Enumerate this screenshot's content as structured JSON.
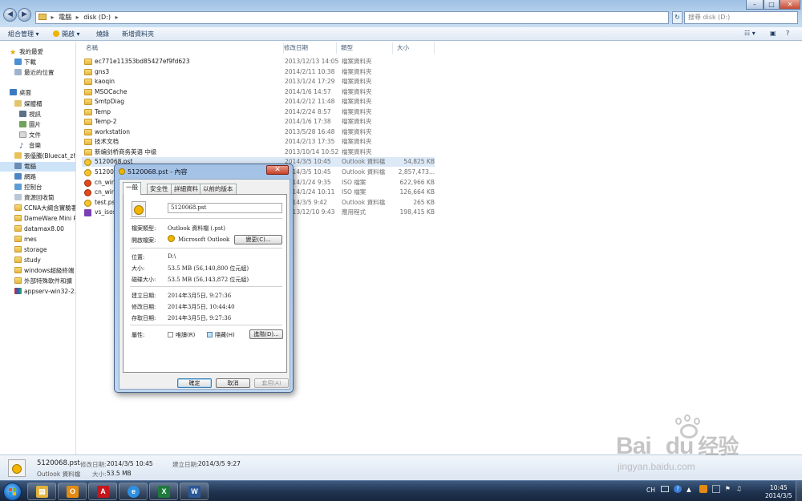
{
  "window": {
    "address": [
      "電腦",
      "disk (D:)"
    ],
    "search_placeholder": "搜尋 disk (D:)",
    "controls": [
      "–",
      "□",
      "✕"
    ]
  },
  "toolbar": {
    "organize": "組合管理",
    "open": "開啟",
    "burn": "燒錄",
    "new_folder": "新增資料夾"
  },
  "navpane": {
    "items": [
      {
        "label": "我的最愛",
        "icon": "star-icon"
      },
      {
        "label": "下載",
        "icon": "download-folder-icon"
      },
      {
        "label": "最近的位置",
        "icon": "recent-places-icon"
      },
      {
        "label": "桌面",
        "icon": "desktop-icon"
      },
      {
        "label": "媒體櫃",
        "icon": "library-icon"
      },
      {
        "label": "視訊",
        "icon": "video-icon"
      },
      {
        "label": "圖片",
        "icon": "picture-icon"
      },
      {
        "label": "文件",
        "icon": "document-icon"
      },
      {
        "label": "音樂",
        "icon": "music-icon"
      },
      {
        "label": "張優騰(Bluecat_zha",
        "icon": "user-folder-icon"
      },
      {
        "label": "電腦",
        "icon": "computer-icon"
      },
      {
        "label": "網路",
        "icon": "network-icon"
      },
      {
        "label": "控制台",
        "icon": "control-panel-icon"
      },
      {
        "label": "資源回收筒",
        "icon": "recycle-bin-icon"
      },
      {
        "label": "CCNA大綱含實驗著",
        "icon": "folder-icon"
      },
      {
        "label": "DameWare Mini Re",
        "icon": "folder-icon"
      },
      {
        "label": "datamax8.00",
        "icon": "folder-icon"
      },
      {
        "label": "mes",
        "icon": "folder-icon"
      },
      {
        "label": "storage",
        "icon": "folder-icon"
      },
      {
        "label": "study",
        "icon": "folder-icon"
      },
      {
        "label": "windows超級終端",
        "icon": "folder-icon"
      },
      {
        "label": "外部特殊軟件和擴",
        "icon": "folder-icon"
      },
      {
        "label": "appserv-win32-2.5",
        "icon": "archive-icon"
      }
    ]
  },
  "filelist": {
    "columns": [
      "名稱",
      "修改日期",
      "類型",
      "大小"
    ],
    "rows": [
      {
        "name": "ec771e11353bd85427ef9fd623",
        "date": "2013/12/13 14:05",
        "type": "檔案資料夾",
        "size": "",
        "kind": "folder"
      },
      {
        "name": "gns3",
        "date": "2014/2/11 10:38",
        "type": "檔案資料夾",
        "size": "",
        "kind": "folder"
      },
      {
        "name": "kaoqin",
        "date": "2013/1/24 17:29",
        "type": "檔案資料夾",
        "size": "",
        "kind": "folder"
      },
      {
        "name": "MSOCache",
        "date": "2014/1/6 14:57",
        "type": "檔案資料夾",
        "size": "",
        "kind": "folder"
      },
      {
        "name": "SmtpDiag",
        "date": "2014/2/12 11:48",
        "type": "檔案資料夾",
        "size": "",
        "kind": "folder"
      },
      {
        "name": "Temp",
        "date": "2014/2/24 8:57",
        "type": "檔案資料夾",
        "size": "",
        "kind": "folder"
      },
      {
        "name": "Temp-2",
        "date": "2014/1/6 17:38",
        "type": "檔案資料夾",
        "size": "",
        "kind": "folder"
      },
      {
        "name": "workstation",
        "date": "2013/5/28 16:48",
        "type": "檔案資料夾",
        "size": "",
        "kind": "folder"
      },
      {
        "name": "技术文档",
        "date": "2014/2/13 17:35",
        "type": "檔案資料夾",
        "size": "",
        "kind": "folder"
      },
      {
        "name": "新编剑桥商务英语 中级",
        "date": "2013/10/14 10:52",
        "type": "檔案資料夾",
        "size": "",
        "kind": "folder"
      },
      {
        "name": "5120068.pst",
        "date": "2014/3/5 10:45",
        "type": "Outlook 資料檔",
        "size": "54,825 KB",
        "kind": "pst"
      },
      {
        "name": "5120068",
        "date": "2014/3/5 10:45",
        "type": "Outlook 資料檔",
        "size": "2,857,473...",
        "kind": "pst"
      },
      {
        "name": "cn_win_",
        "date": "2014/1/24 9:35",
        "type": "ISO 檔案",
        "size": "622,966 KB",
        "kind": "iso"
      },
      {
        "name": "cn_win_",
        "date": "2014/1/24 10:11",
        "type": "ISO 檔案",
        "size": "126,664 KB",
        "kind": "iso"
      },
      {
        "name": "test.pst",
        "date": "2014/3/5 9:42",
        "type": "Outlook 資料檔",
        "size": "265 KB",
        "kind": "pst"
      },
      {
        "name": "vs_isos",
        "date": "2013/12/10 9:43",
        "type": "應用程式",
        "size": "198,415 KB",
        "kind": "app"
      }
    ]
  },
  "details": {
    "filename": "5120068.pst",
    "type": "Outlook 資料檔",
    "modified_label": "修改日期:",
    "modified": "2014/3/5 10:45",
    "size_label": "大小:",
    "size": "53.5 MB",
    "created_label": "建立日期:",
    "created": "2014/3/5 9:27"
  },
  "dialog": {
    "title": "5120068.pst - 內容",
    "tabs": [
      "一般",
      "安全性",
      "詳細資料",
      "以前的版本"
    ],
    "filename": "5120068.pst",
    "file_type_label": "檔案類型:",
    "file_type": "Outlook 資料檔 (.pst)",
    "opens_with_label": "開啟檔案:",
    "opens_with": "Microsoft Outlook",
    "change_button": "變更(C)...",
    "location_label": "位置:",
    "location": "D:\\",
    "size_label": "大小:",
    "size": "53.5 MB (56,140,800 位元組)",
    "size_on_disk_label": "磁碟大小:",
    "size_on_disk": "53.5 MB (56,143,872 位元組)",
    "created_label": "建立日期:",
    "created": "2014年3月5日, 9:27:36",
    "modified_label": "修改日期:",
    "modified": "2014年3月5日, 10:44:40",
    "accessed_label": "存取日期:",
    "accessed": "2014年3月5日, 9:27:36",
    "attributes_label": "屬性:",
    "readonly_label": "唯讀(R)",
    "hidden_label": "隱藏(H)",
    "advanced_button": "進階(D)...",
    "ok_button": "確定",
    "cancel_button": "取消",
    "apply_button": "套用(A)"
  },
  "taskbar": {
    "apps": [
      {
        "name": "explorer",
        "glyph": "▤",
        "color": "#e2b23c"
      },
      {
        "name": "outlook",
        "glyph": "O",
        "color": "#e48a12"
      },
      {
        "name": "acrobat",
        "glyph": "A",
        "color": "#c4161c"
      },
      {
        "name": "internet-explorer",
        "glyph": "e",
        "color": "#2e8fe0"
      },
      {
        "name": "excel",
        "glyph": "X",
        "color": "#1e7a3c"
      },
      {
        "name": "word",
        "glyph": "W",
        "color": "#2b5797"
      }
    ],
    "ime": "CH",
    "time": "10:45",
    "date": "2014/3/5"
  },
  "watermark": {
    "brand": "Bai",
    "brand2": "du",
    "brand_cn": "经验",
    "url": "jingyan.baidu.com"
  }
}
